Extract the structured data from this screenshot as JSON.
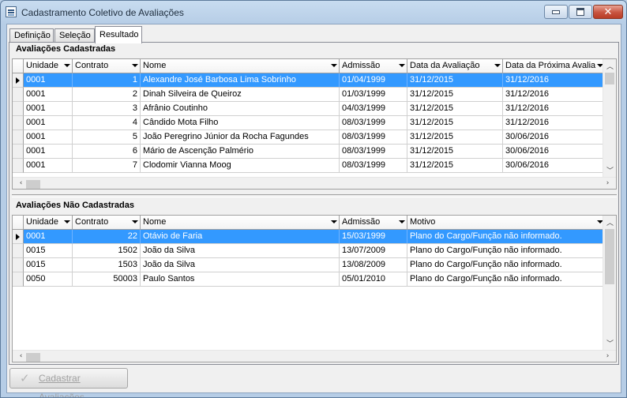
{
  "window": {
    "title": "Cadastramento Coletivo de Avaliações"
  },
  "tabs": [
    {
      "label": "Definição",
      "active": false
    },
    {
      "label": "Seleção",
      "active": false
    },
    {
      "label": "Resultado",
      "active": true
    }
  ],
  "registered": {
    "title": "Avaliações Cadastradas",
    "columns": [
      "Unidade",
      "Contrato",
      "Nome",
      "Admissão",
      "Data da Avaliação",
      "Data da Próxima Avalia"
    ],
    "rows": [
      [
        "0001",
        "1",
        "Alexandre José Barbosa Lima Sobrinho",
        "01/04/1999",
        "31/12/2015",
        "31/12/2016"
      ],
      [
        "0001",
        "2",
        "Dinah Silveira de Queiroz",
        "01/03/1999",
        "31/12/2015",
        "31/12/2016"
      ],
      [
        "0001",
        "3",
        "Afrânio Coutinho",
        "04/03/1999",
        "31/12/2015",
        "31/12/2016"
      ],
      [
        "0001",
        "4",
        "Cândido Mota Filho",
        "08/03/1999",
        "31/12/2015",
        "31/12/2016"
      ],
      [
        "0001",
        "5",
        "João Peregrino Júnior da Rocha Fagundes",
        "08/03/1999",
        "31/12/2015",
        "30/06/2016"
      ],
      [
        "0001",
        "6",
        "Mário de Ascenção Palmério",
        "08/03/1999",
        "31/12/2015",
        "30/06/2016"
      ],
      [
        "0001",
        "7",
        "Clodomir Vianna Moog",
        "08/03/1999",
        "31/12/2015",
        "30/06/2016"
      ]
    ]
  },
  "not_registered": {
    "title": "Avaliações Não Cadastradas",
    "columns": [
      "Unidade",
      "Contrato",
      "Nome",
      "Admissão",
      "Motivo"
    ],
    "rows": [
      [
        "0001",
        "22",
        "Otávio de Faria",
        "15/03/1999",
        "Plano do Cargo/Função não informado."
      ],
      [
        "0015",
        "1502",
        "João da Silva",
        "13/07/2009",
        "Plano do Cargo/Função não informado."
      ],
      [
        "0015",
        "1503",
        "João da Silva",
        "13/08/2009",
        "Plano do Cargo/Função não informado."
      ],
      [
        "0050",
        "50003",
        "Paulo Santos",
        "05/01/2010",
        "Plano do Cargo/Função não informado."
      ]
    ]
  },
  "footer": {
    "submit_label": "Cadastrar Avaliações"
  },
  "icons": {
    "app": "form-icon",
    "submit": "checkmark-icon"
  }
}
